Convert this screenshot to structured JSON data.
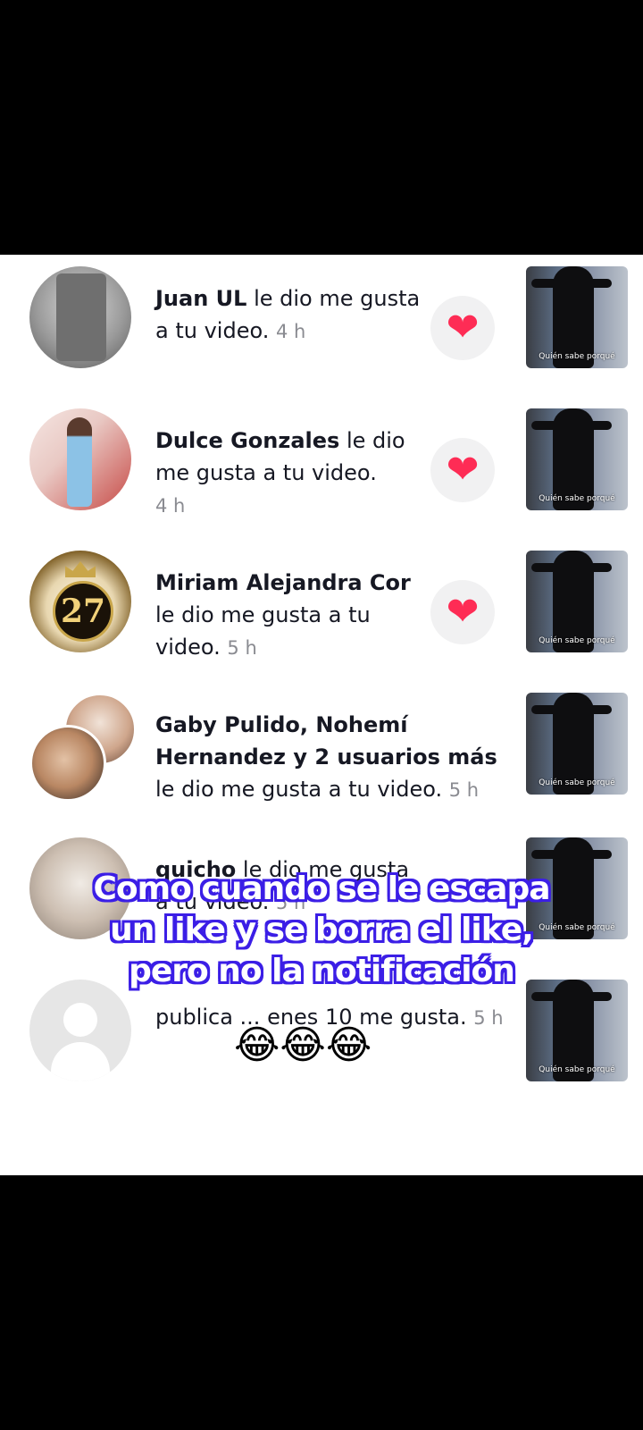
{
  "notifications": [
    {
      "name": "Juan UL",
      "action": " le dio me gusta a tu video.",
      "time": "4 h"
    },
    {
      "name": "Dulce Gonzales",
      "action": " le dio me gusta a tu video.",
      "time": "4 h"
    },
    {
      "name": "Miriam Alejandra Cor",
      "action": " le dio me gusta a tu video.",
      "time": "5 h"
    },
    {
      "name": "Gaby Pulido, Nohemí Hernandez y 2 usuarios más",
      "action": " le dio me gusta a tu video.",
      "time": "5 h"
    },
    {
      "name": "quicho",
      "action": " le dio me gusta a tu video.",
      "time": "5 h"
    },
    {
      "name": "",
      "action": "publica ... enes 10 me gusta.",
      "time": "5 h"
    }
  ],
  "avatar_badge": "27",
  "heart_icon": "❤",
  "thumb_caption": "Quién sabe porqué",
  "overlay": {
    "caption_line1": "Como cuando se le escapa",
    "caption_line2": "un like y se borra el like,",
    "caption_line3": "pero no la notificación",
    "emojis": "😂😂😂"
  },
  "colors": {
    "heart": "#fe2c55",
    "caption_outline": "#3b1ee6"
  }
}
